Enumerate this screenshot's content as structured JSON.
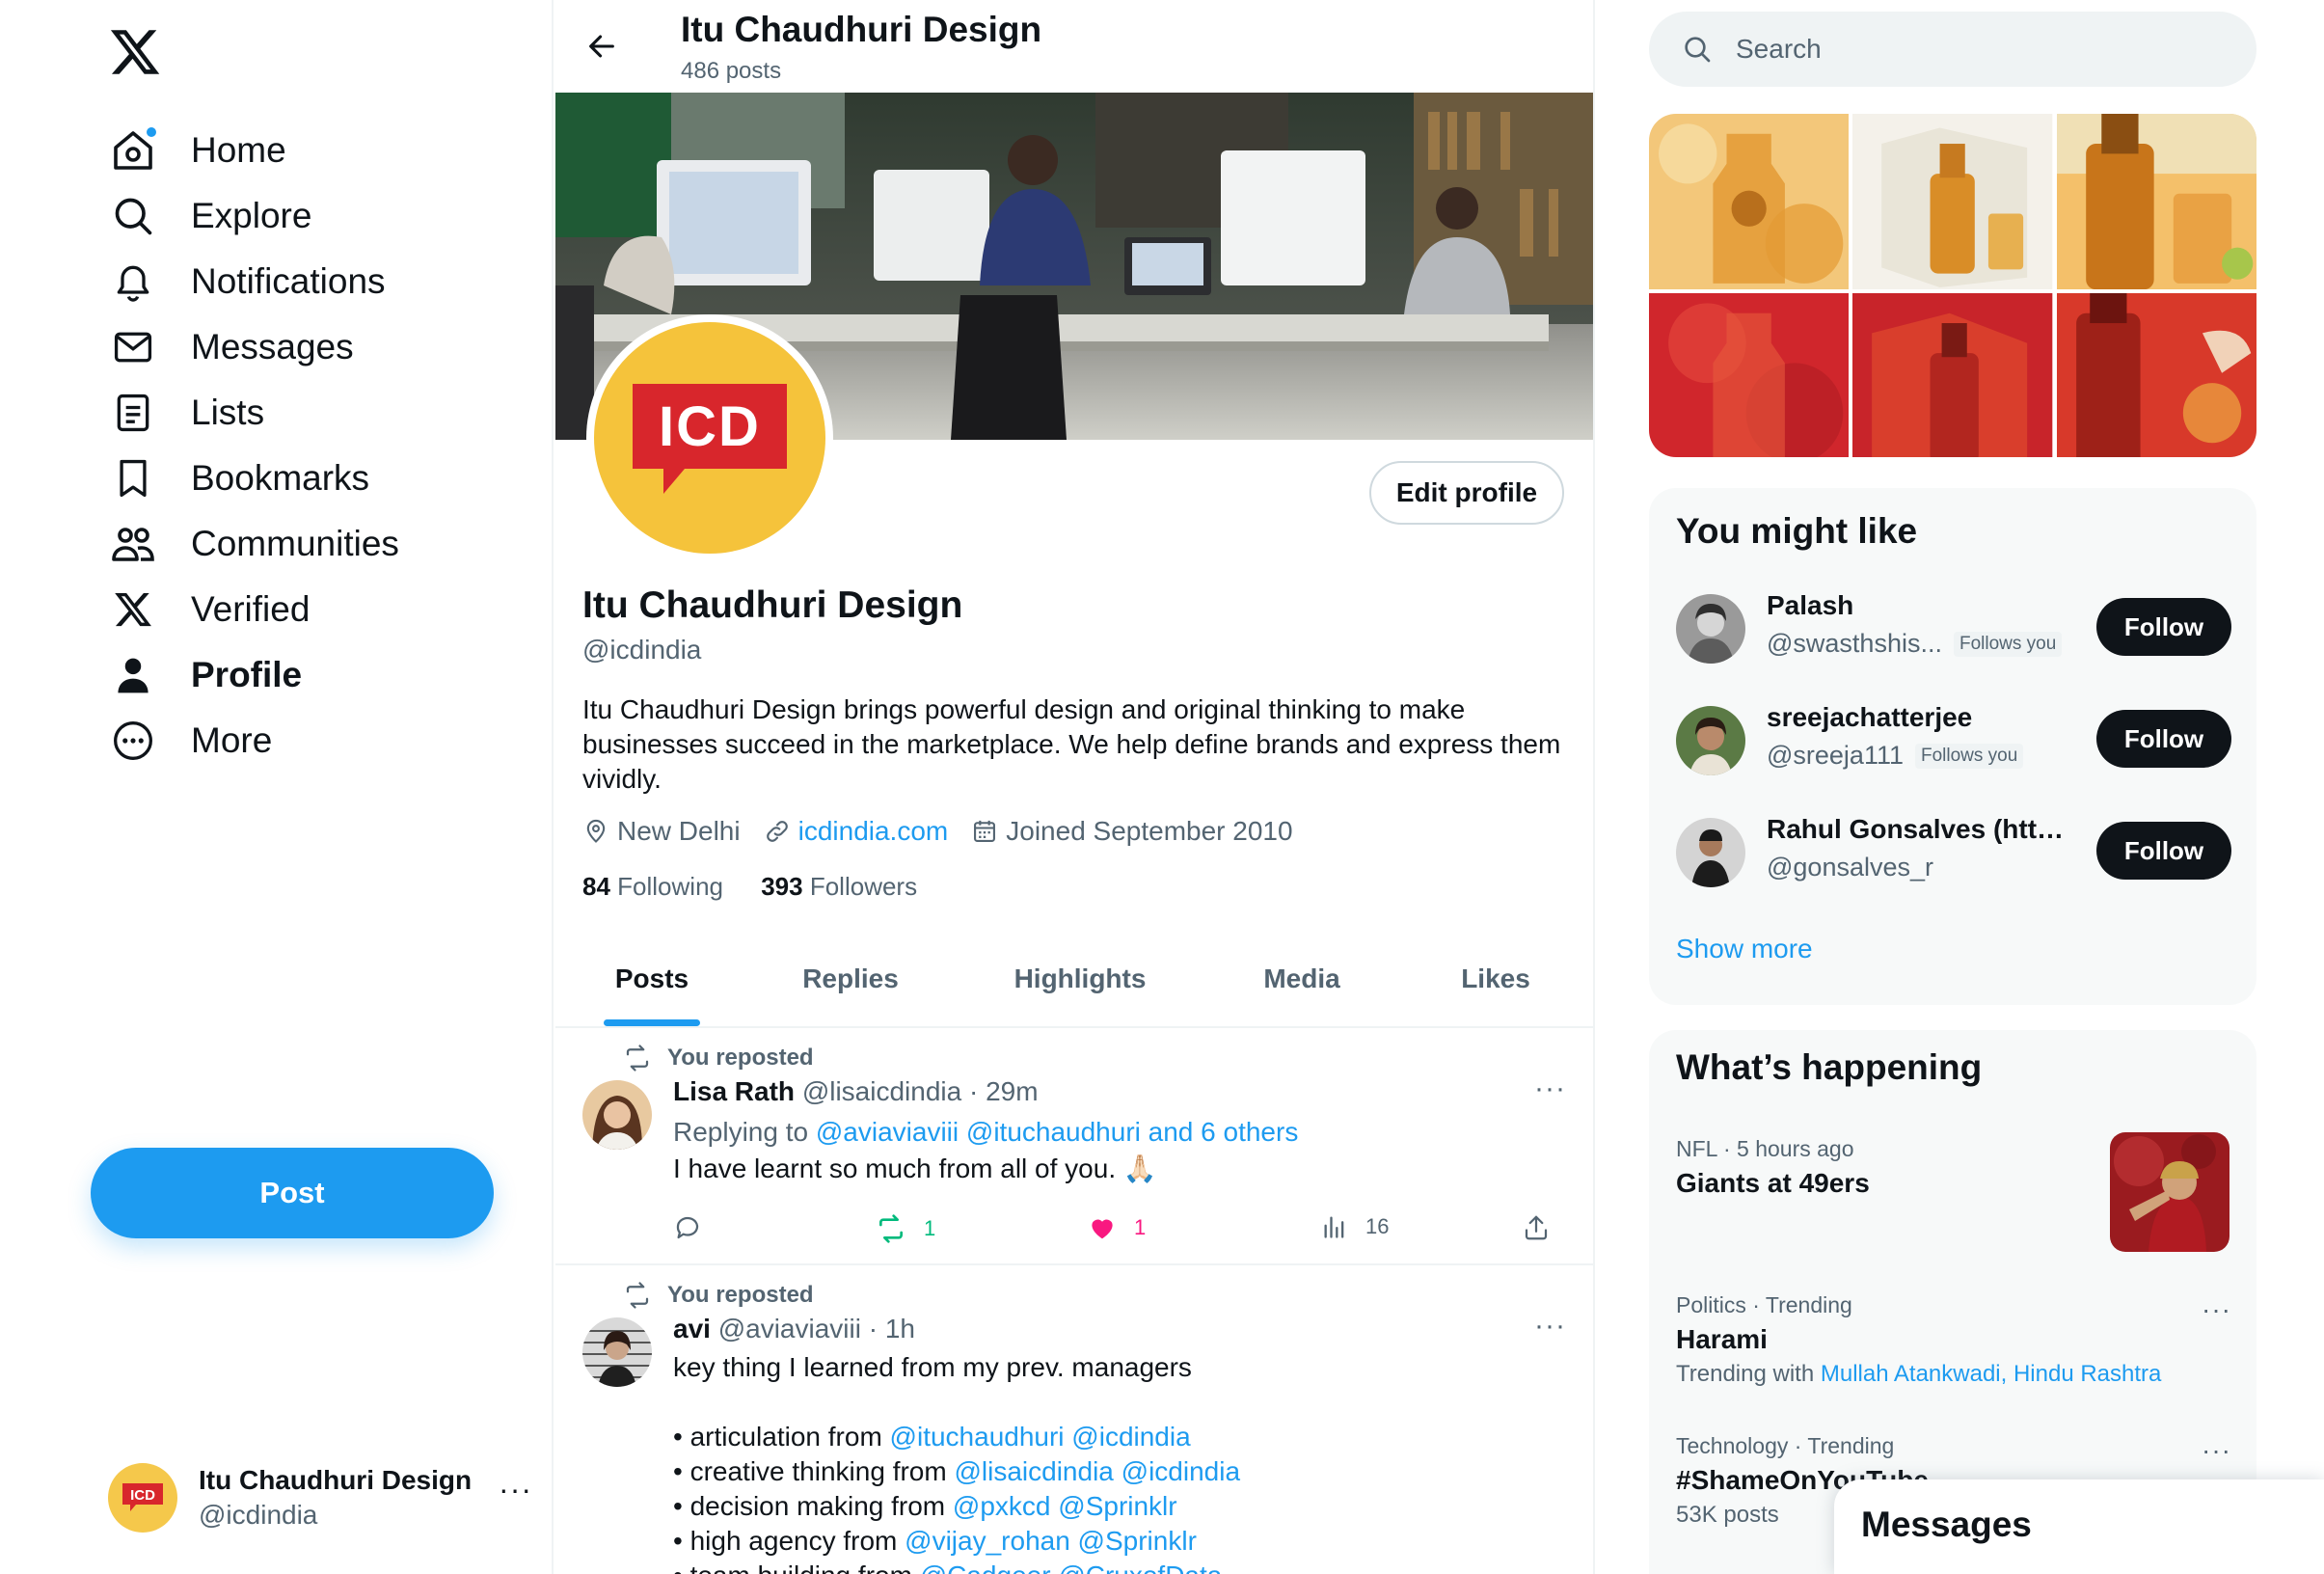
{
  "nav": {
    "items": [
      {
        "label": "Home",
        "icon": "home-icon"
      },
      {
        "label": "Explore",
        "icon": "search-icon"
      },
      {
        "label": "Notifications",
        "icon": "bell-icon"
      },
      {
        "label": "Messages",
        "icon": "envelope-icon"
      },
      {
        "label": "Lists",
        "icon": "list-icon"
      },
      {
        "label": "Bookmarks",
        "icon": "bookmark-icon"
      },
      {
        "label": "Communities",
        "icon": "people-icon"
      },
      {
        "label": "Verified",
        "icon": "x-logo-icon"
      },
      {
        "label": "Profile",
        "icon": "person-icon"
      },
      {
        "label": "More",
        "icon": "more-circle-icon"
      }
    ],
    "post_label": "Post",
    "account": {
      "name": "Itu Chaudhuri Design",
      "handle": "@icdindia",
      "avatar_text": "ICD"
    }
  },
  "header": {
    "title": "Itu Chaudhuri Design",
    "subtitle": "486 posts"
  },
  "profile": {
    "avatar_text": "ICD",
    "edit_label": "Edit profile",
    "name": "Itu Chaudhuri Design",
    "handle": "@icdindia",
    "bio": "Itu Chaudhuri Design brings powerful design and original thinking to make businesses succeed in the marketplace. We help define brands and express them vividly.",
    "location": "New Delhi",
    "website": "icdindia.com",
    "joined": "Joined September 2010",
    "following_count": "84",
    "following_label": "Following",
    "followers_count": "393",
    "followers_label": "Followers"
  },
  "tabs": [
    {
      "label": "Posts",
      "active": true
    },
    {
      "label": "Replies",
      "active": false
    },
    {
      "label": "Highlights",
      "active": false
    },
    {
      "label": "Media",
      "active": false
    },
    {
      "label": "Likes",
      "active": false
    }
  ],
  "tweets": [
    {
      "repost_label": "You reposted",
      "name": "Lisa Rath",
      "handle_time": "@lisaicdindia · 29m",
      "replying_prefix": "Replying to",
      "replying_to": "@aviaviaviii @ituchaudhuri and 6 others",
      "text": "I have learnt so much from all of you. 🙏🏻",
      "retweets": "1",
      "likes": "1",
      "views": "16"
    },
    {
      "repost_label": "You reposted",
      "name": "avi",
      "handle_time": "@aviaviaviii · 1h",
      "lines": [
        {
          "prefix": "key thing I learned from my prev. managers",
          "mention": ""
        },
        {
          "prefix": "",
          "mention": ""
        },
        {
          "prefix": "• articulation from ",
          "mention": "@ituchaudhuri @icdindia"
        },
        {
          "prefix": "• creative thinking from ",
          "mention": "@lisaicdindia @icdindia"
        },
        {
          "prefix": "• decision making from ",
          "mention": "@pxkcd @Sprinklr"
        },
        {
          "prefix": "• high agency from ",
          "mention": "@vijay_rohan @Sprinklr"
        },
        {
          "prefix": "• team building from ",
          "mention": "@Cadgeer @CruxofData"
        }
      ]
    }
  ],
  "right": {
    "search_placeholder": "Search",
    "who_title": "You might like",
    "who": [
      {
        "name": "Palash",
        "handle": "@swasthshis...",
        "follows_you": "Follows you",
        "button": "Follow"
      },
      {
        "name": "sreejachatterjee",
        "handle": "@sreeja111",
        "follows_you": "Follows you",
        "button": "Follow"
      },
      {
        "name": "Rahul Gonsalves (http...",
        "handle": "@gonsalves_r",
        "follows_you": "",
        "button": "Follow"
      }
    ],
    "show_more": "Show more",
    "happening_title": "What’s happening",
    "trends": [
      {
        "meta": "NFL · 5 hours ago",
        "title": "Giants at 49ers",
        "sub_prefix": "",
        "sub_links": ""
      },
      {
        "meta": "Politics · Trending",
        "title": "Harami",
        "sub_prefix": "Trending with",
        "sub_links": "Mullah Atankwadi, Hindu Rashtra"
      },
      {
        "meta": "Technology · Trending",
        "title": "#ShameOnYouTube",
        "sub_prefix": "53K posts",
        "sub_links": ""
      }
    ],
    "messages_drawer": "Messages"
  },
  "colors": {
    "accent": "#1d9bf0",
    "text": "#0f1419",
    "muted": "#536471",
    "retweet": "#00ba7c",
    "like": "#f91880",
    "icd_red": "#d8262c",
    "icd_yellow": "#f5c33b"
  }
}
